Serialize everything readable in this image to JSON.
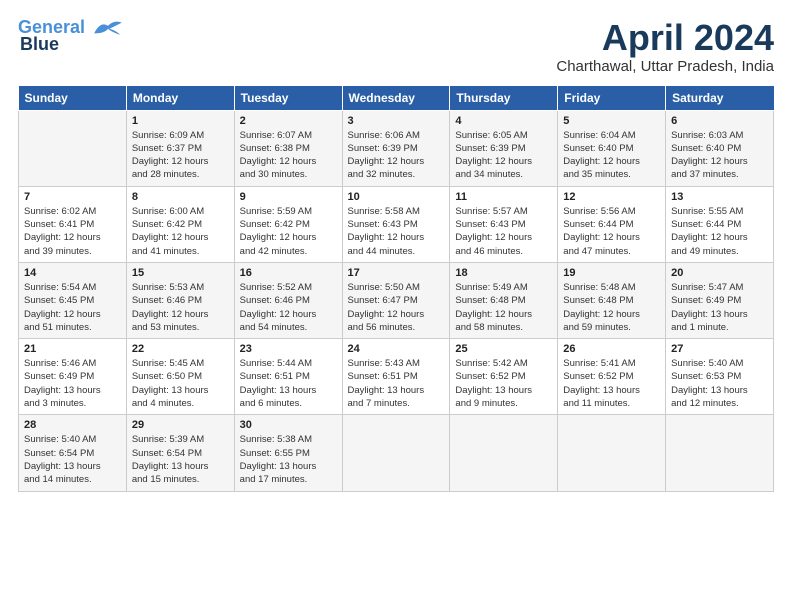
{
  "header": {
    "logo_line1": "General",
    "logo_line2": "Blue",
    "month_title": "April 2024",
    "location": "Charthawal, Uttar Pradesh, India"
  },
  "weekdays": [
    "Sunday",
    "Monday",
    "Tuesday",
    "Wednesday",
    "Thursday",
    "Friday",
    "Saturday"
  ],
  "weeks": [
    [
      {
        "day": "",
        "info": ""
      },
      {
        "day": "1",
        "info": "Sunrise: 6:09 AM\nSunset: 6:37 PM\nDaylight: 12 hours\nand 28 minutes."
      },
      {
        "day": "2",
        "info": "Sunrise: 6:07 AM\nSunset: 6:38 PM\nDaylight: 12 hours\nand 30 minutes."
      },
      {
        "day": "3",
        "info": "Sunrise: 6:06 AM\nSunset: 6:39 PM\nDaylight: 12 hours\nand 32 minutes."
      },
      {
        "day": "4",
        "info": "Sunrise: 6:05 AM\nSunset: 6:39 PM\nDaylight: 12 hours\nand 34 minutes."
      },
      {
        "day": "5",
        "info": "Sunrise: 6:04 AM\nSunset: 6:40 PM\nDaylight: 12 hours\nand 35 minutes."
      },
      {
        "day": "6",
        "info": "Sunrise: 6:03 AM\nSunset: 6:40 PM\nDaylight: 12 hours\nand 37 minutes."
      }
    ],
    [
      {
        "day": "7",
        "info": "Sunrise: 6:02 AM\nSunset: 6:41 PM\nDaylight: 12 hours\nand 39 minutes."
      },
      {
        "day": "8",
        "info": "Sunrise: 6:00 AM\nSunset: 6:42 PM\nDaylight: 12 hours\nand 41 minutes."
      },
      {
        "day": "9",
        "info": "Sunrise: 5:59 AM\nSunset: 6:42 PM\nDaylight: 12 hours\nand 42 minutes."
      },
      {
        "day": "10",
        "info": "Sunrise: 5:58 AM\nSunset: 6:43 PM\nDaylight: 12 hours\nand 44 minutes."
      },
      {
        "day": "11",
        "info": "Sunrise: 5:57 AM\nSunset: 6:43 PM\nDaylight: 12 hours\nand 46 minutes."
      },
      {
        "day": "12",
        "info": "Sunrise: 5:56 AM\nSunset: 6:44 PM\nDaylight: 12 hours\nand 47 minutes."
      },
      {
        "day": "13",
        "info": "Sunrise: 5:55 AM\nSunset: 6:44 PM\nDaylight: 12 hours\nand 49 minutes."
      }
    ],
    [
      {
        "day": "14",
        "info": "Sunrise: 5:54 AM\nSunset: 6:45 PM\nDaylight: 12 hours\nand 51 minutes."
      },
      {
        "day": "15",
        "info": "Sunrise: 5:53 AM\nSunset: 6:46 PM\nDaylight: 12 hours\nand 53 minutes."
      },
      {
        "day": "16",
        "info": "Sunrise: 5:52 AM\nSunset: 6:46 PM\nDaylight: 12 hours\nand 54 minutes."
      },
      {
        "day": "17",
        "info": "Sunrise: 5:50 AM\nSunset: 6:47 PM\nDaylight: 12 hours\nand 56 minutes."
      },
      {
        "day": "18",
        "info": "Sunrise: 5:49 AM\nSunset: 6:48 PM\nDaylight: 12 hours\nand 58 minutes."
      },
      {
        "day": "19",
        "info": "Sunrise: 5:48 AM\nSunset: 6:48 PM\nDaylight: 12 hours\nand 59 minutes."
      },
      {
        "day": "20",
        "info": "Sunrise: 5:47 AM\nSunset: 6:49 PM\nDaylight: 13 hours\nand 1 minute."
      }
    ],
    [
      {
        "day": "21",
        "info": "Sunrise: 5:46 AM\nSunset: 6:49 PM\nDaylight: 13 hours\nand 3 minutes."
      },
      {
        "day": "22",
        "info": "Sunrise: 5:45 AM\nSunset: 6:50 PM\nDaylight: 13 hours\nand 4 minutes."
      },
      {
        "day": "23",
        "info": "Sunrise: 5:44 AM\nSunset: 6:51 PM\nDaylight: 13 hours\nand 6 minutes."
      },
      {
        "day": "24",
        "info": "Sunrise: 5:43 AM\nSunset: 6:51 PM\nDaylight: 13 hours\nand 7 minutes."
      },
      {
        "day": "25",
        "info": "Sunrise: 5:42 AM\nSunset: 6:52 PM\nDaylight: 13 hours\nand 9 minutes."
      },
      {
        "day": "26",
        "info": "Sunrise: 5:41 AM\nSunset: 6:52 PM\nDaylight: 13 hours\nand 11 minutes."
      },
      {
        "day": "27",
        "info": "Sunrise: 5:40 AM\nSunset: 6:53 PM\nDaylight: 13 hours\nand 12 minutes."
      }
    ],
    [
      {
        "day": "28",
        "info": "Sunrise: 5:40 AM\nSunset: 6:54 PM\nDaylight: 13 hours\nand 14 minutes."
      },
      {
        "day": "29",
        "info": "Sunrise: 5:39 AM\nSunset: 6:54 PM\nDaylight: 13 hours\nand 15 minutes."
      },
      {
        "day": "30",
        "info": "Sunrise: 5:38 AM\nSunset: 6:55 PM\nDaylight: 13 hours\nand 17 minutes."
      },
      {
        "day": "",
        "info": ""
      },
      {
        "day": "",
        "info": ""
      },
      {
        "day": "",
        "info": ""
      },
      {
        "day": "",
        "info": ""
      }
    ]
  ]
}
